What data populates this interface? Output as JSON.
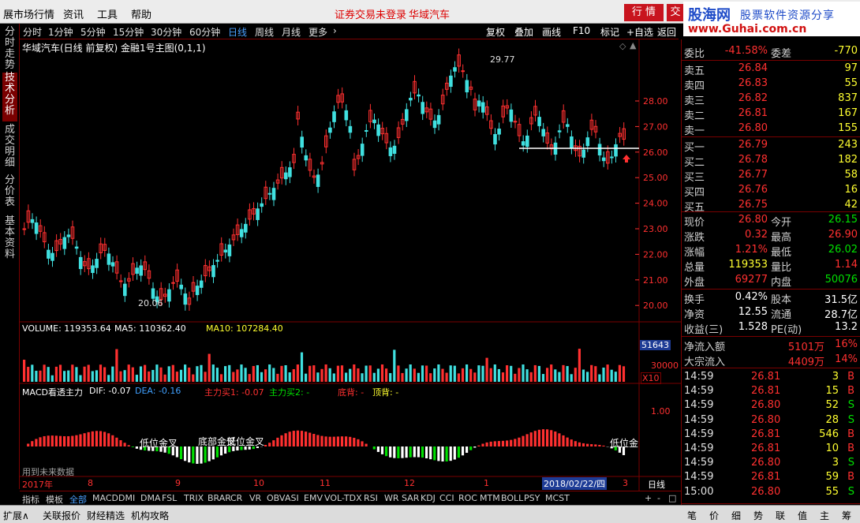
{
  "menubar": {
    "app_title": "展市场行情",
    "menus": [
      "资讯",
      "工具",
      "帮助"
    ],
    "notice": "证券交易未登录",
    "stock_name": "华域汽车",
    "btn_quote": "行 情",
    "btn_trade": "交",
    "logo_main": "股海网",
    "logo_sub": "股票软件资源分享",
    "logo_url": "www.Guhai.com.cn"
  },
  "left_tabs": [
    "分时走势",
    "技术分析",
    "成交明细",
    "分价表",
    "基本资料"
  ],
  "period_tabs": [
    "分时",
    "1分钟",
    "5分钟",
    "15分钟",
    "30分钟",
    "60分钟",
    "日线",
    "周线",
    "月线",
    "更多"
  ],
  "period_active": "日线",
  "right_tools": [
    "复权",
    "叠加",
    "画线",
    "F10",
    "标记",
    "+自选",
    "返回"
  ],
  "chart_header": "华域汽车(日线 前复权) 金融1号主图(0,1,1)",
  "price_axis": [
    "28.00",
    "27.00",
    "26.00",
    "25.00",
    "24.00",
    "23.00",
    "22.00",
    "21.00",
    "20.00"
  ],
  "high_label": "29.77",
  "low_label": "20.06",
  "volume_header": {
    "vol": "VOLUME: 119353.64",
    "ma5": "MA5: 110362.40",
    "ma10": "MA10: 107284.40"
  },
  "volume_axis": [
    "51643",
    "30000",
    "X10"
  ],
  "macd_header": {
    "name": "MACD看透主力",
    "dif": "DIF: -0.07",
    "dea": "DEA: -0.16",
    "main1": "主力买1: -0.07",
    "main2": "主力买2: -",
    "bottom": "底背: -",
    "top": "顶背: -"
  },
  "macd_axis": [
    "1.00"
  ],
  "macd_labels": [
    "低位金叉",
    "底部金叉",
    "低位金叉",
    "低位金"
  ],
  "future_note": "用到未来数据",
  "date_axis": [
    "2017年",
    "8",
    "9",
    "10",
    "11",
    "12",
    "1",
    "2018/02/22/四",
    "3"
  ],
  "day_btn": "日线",
  "indicator_tabs": [
    "指标",
    "模板",
    "全部",
    "MACD",
    "DMI",
    "DMA",
    "FSL",
    "TRIX",
    "BRAR",
    "CR",
    "VR",
    "OBV",
    "ASI",
    "EMV",
    "VOL-TDX",
    "RSI",
    "WR",
    "SAR",
    "KDJ",
    "CCI",
    "ROC",
    "MTM",
    "BOLL",
    "PSY",
    "MCST"
  ],
  "indicator_active": "全部",
  "quote": {
    "weibi_label": "委比",
    "weibi": "-41.58%",
    "weicha_label": "委差",
    "weicha": "-770",
    "asks": [
      {
        "label": "卖五",
        "price": "26.84",
        "vol": "97"
      },
      {
        "label": "卖四",
        "price": "26.83",
        "vol": "55"
      },
      {
        "label": "卖三",
        "price": "26.82",
        "vol": "837"
      },
      {
        "label": "卖二",
        "price": "26.81",
        "vol": "167"
      },
      {
        "label": "卖一",
        "price": "26.80",
        "vol": "155"
      }
    ],
    "bids": [
      {
        "label": "买一",
        "price": "26.79",
        "vol": "243"
      },
      {
        "label": "买二",
        "price": "26.78",
        "vol": "182"
      },
      {
        "label": "买三",
        "price": "26.77",
        "vol": "58"
      },
      {
        "label": "买四",
        "price": "26.76",
        "vol": "16"
      },
      {
        "label": "买五",
        "price": "26.75",
        "vol": "42"
      }
    ],
    "stats": [
      {
        "l1": "现价",
        "v1": "26.80",
        "c1": "red",
        "l2": "今开",
        "v2": "26.15",
        "c2": "green"
      },
      {
        "l1": "涨跌",
        "v1": "0.32",
        "c1": "red",
        "l2": "最高",
        "v2": "26.90",
        "c2": "red"
      },
      {
        "l1": "涨幅",
        "v1": "1.21%",
        "c1": "red",
        "l2": "最低",
        "v2": "26.02",
        "c2": "green"
      },
      {
        "l1": "总量",
        "v1": "119353",
        "c1": "yellow",
        "l2": "量比",
        "v2": "1.14",
        "c2": "red"
      },
      {
        "l1": "外盘",
        "v1": "69277",
        "c1": "red",
        "l2": "内盘",
        "v2": "50076",
        "c2": "green"
      }
    ],
    "stats2": [
      {
        "l1": "换手",
        "v1": "0.42%",
        "l2": "股本",
        "v2": "31.5亿"
      },
      {
        "l1": "净资",
        "v1": "12.55",
        "l2": "流通",
        "v2": "28.7亿"
      },
      {
        "l1": "收益(三)",
        "v1": "1.528",
        "l2": "PE(动)",
        "v2": "13.2"
      }
    ],
    "flow": [
      {
        "label": "净流入额",
        "val": "5101万",
        "pct": "16%"
      },
      {
        "label": "大宗流入",
        "val": "4409万",
        "pct": "14%"
      }
    ],
    "ticks": [
      {
        "t": "14:59",
        "p": "26.81",
        "q": "3",
        "bs": "B"
      },
      {
        "t": "14:59",
        "p": "26.81",
        "q": "15",
        "bs": "B"
      },
      {
        "t": "14:59",
        "p": "26.80",
        "q": "52",
        "bs": "S"
      },
      {
        "t": "14:59",
        "p": "26.80",
        "q": "28",
        "bs": "S"
      },
      {
        "t": "14:59",
        "p": "26.81",
        "q": "546",
        "bs": "B"
      },
      {
        "t": "14:59",
        "p": "26.81",
        "q": "10",
        "bs": "B"
      },
      {
        "t": "14:59",
        "p": "26.80",
        "q": "3",
        "bs": "S"
      },
      {
        "t": "14:59",
        "p": "26.81",
        "q": "59",
        "bs": "B"
      },
      {
        "t": "15:00",
        "p": "26.80",
        "q": "55",
        "bs": "S"
      }
    ]
  },
  "status_tabs": [
    "扩展∧",
    "关联报价",
    "财经精选",
    "机构攻略"
  ],
  "right_bottom_tabs": [
    "笔",
    "价",
    "细",
    "势",
    "联",
    "值",
    "主",
    "筹"
  ],
  "colors": {
    "up": "#ff3030",
    "down": "#40e0e0",
    "bg": "#000000",
    "grid": "#7a0000"
  }
}
